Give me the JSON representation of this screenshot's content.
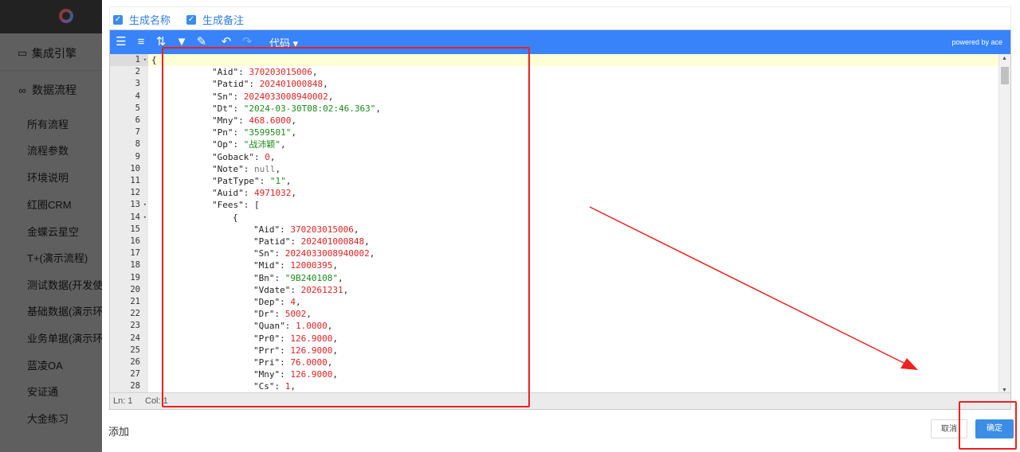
{
  "sidebar": {
    "sections": [
      {
        "icon": "engine-icon",
        "label": "集成引擎"
      },
      {
        "icon": "infinity-icon",
        "label": "数据流程"
      }
    ],
    "items": [
      {
        "label": "所有流程"
      },
      {
        "label": "流程参数"
      },
      {
        "label": "环境说明"
      },
      {
        "label": "红圈CRM"
      },
      {
        "label": "金蝶云星空"
      },
      {
        "label": "T+(演示流程)"
      },
      {
        "label": "测试数据(开发使用"
      },
      {
        "label": "基础数据(演示环境"
      },
      {
        "label": "业务单据(演示环境"
      },
      {
        "label": "蓝凌OA"
      },
      {
        "label": "安证通"
      },
      {
        "label": "大金练习"
      }
    ]
  },
  "options": {
    "generate_name": {
      "label": "生成名称",
      "checked": true
    },
    "generate_remark": {
      "label": "生成备注",
      "checked": true
    }
  },
  "editor": {
    "toolbar": {
      "icons": [
        "format-icon",
        "compact-icon",
        "sort-icon",
        "filter-icon",
        "repair-icon",
        "undo-icon",
        "redo-icon"
      ],
      "mode_label": "代码 ▾",
      "powered_by": "powered by ace"
    },
    "lines": [
      {
        "num": "1",
        "fold": true,
        "indent": 0,
        "text": "{",
        "tokens": [
          {
            "t": "{",
            "c": "p"
          }
        ]
      },
      {
        "num": "2",
        "indent": 1,
        "tokens": [
          {
            "t": "\"Aid\"",
            "c": "k"
          },
          {
            "t": ": ",
            "c": "p"
          },
          {
            "t": "370203015006",
            "c": "n"
          },
          {
            "t": ",",
            "c": "p"
          }
        ]
      },
      {
        "num": "3",
        "indent": 1,
        "tokens": [
          {
            "t": "\"Patid\"",
            "c": "k"
          },
          {
            "t": ": ",
            "c": "p"
          },
          {
            "t": "202401000848",
            "c": "n"
          },
          {
            "t": ",",
            "c": "p"
          }
        ]
      },
      {
        "num": "4",
        "indent": 1,
        "tokens": [
          {
            "t": "\"Sn\"",
            "c": "k"
          },
          {
            "t": ": ",
            "c": "p"
          },
          {
            "t": "2024033008940002",
            "c": "n"
          },
          {
            "t": ",",
            "c": "p"
          }
        ]
      },
      {
        "num": "5",
        "indent": 1,
        "tokens": [
          {
            "t": "\"Dt\"",
            "c": "k"
          },
          {
            "t": ": ",
            "c": "p"
          },
          {
            "t": "\"2024-03-30T08:02:46.363\"",
            "c": "s"
          },
          {
            "t": ",",
            "c": "p"
          }
        ]
      },
      {
        "num": "6",
        "indent": 1,
        "tokens": [
          {
            "t": "\"Mny\"",
            "c": "k"
          },
          {
            "t": ": ",
            "c": "p"
          },
          {
            "t": "468.6000",
            "c": "n"
          },
          {
            "t": ",",
            "c": "p"
          }
        ]
      },
      {
        "num": "7",
        "indent": 1,
        "tokens": [
          {
            "t": "\"Pn\"",
            "c": "k"
          },
          {
            "t": ": ",
            "c": "p"
          },
          {
            "t": "\"3599501\"",
            "c": "s"
          },
          {
            "t": ",",
            "c": "p"
          }
        ]
      },
      {
        "num": "8",
        "indent": 1,
        "tokens": [
          {
            "t": "\"Op\"",
            "c": "k"
          },
          {
            "t": ": ",
            "c": "p"
          },
          {
            "t": "\"战沛颖\"",
            "c": "s"
          },
          {
            "t": ",",
            "c": "p"
          }
        ]
      },
      {
        "num": "9",
        "indent": 1,
        "tokens": [
          {
            "t": "\"Goback\"",
            "c": "k"
          },
          {
            "t": ": ",
            "c": "p"
          },
          {
            "t": "0",
            "c": "n"
          },
          {
            "t": ",",
            "c": "p"
          }
        ]
      },
      {
        "num": "10",
        "indent": 1,
        "tokens": [
          {
            "t": "\"Note\"",
            "c": "k"
          },
          {
            "t": ": ",
            "c": "p"
          },
          {
            "t": "null",
            "c": "nl"
          },
          {
            "t": ",",
            "c": "p"
          }
        ]
      },
      {
        "num": "11",
        "indent": 1,
        "tokens": [
          {
            "t": "\"PatType\"",
            "c": "k"
          },
          {
            "t": ": ",
            "c": "p"
          },
          {
            "t": "\"1\"",
            "c": "s"
          },
          {
            "t": ",",
            "c": "p"
          }
        ]
      },
      {
        "num": "12",
        "indent": 1,
        "tokens": [
          {
            "t": "\"Auid\"",
            "c": "k"
          },
          {
            "t": ": ",
            "c": "p"
          },
          {
            "t": "4971032",
            "c": "n"
          },
          {
            "t": ",",
            "c": "p"
          }
        ]
      },
      {
        "num": "13",
        "fold": true,
        "indent": 1,
        "tokens": [
          {
            "t": "\"Fees\"",
            "c": "k"
          },
          {
            "t": ": [",
            "c": "p"
          }
        ]
      },
      {
        "num": "14",
        "fold": true,
        "indent": 2,
        "tokens": [
          {
            "t": "{",
            "c": "p"
          }
        ]
      },
      {
        "num": "15",
        "indent": 3,
        "tokens": [
          {
            "t": "\"Aid\"",
            "c": "k"
          },
          {
            "t": ": ",
            "c": "p"
          },
          {
            "t": "370203015006",
            "c": "n"
          },
          {
            "t": ",",
            "c": "p"
          }
        ]
      },
      {
        "num": "16",
        "indent": 3,
        "tokens": [
          {
            "t": "\"Patid\"",
            "c": "k"
          },
          {
            "t": ": ",
            "c": "p"
          },
          {
            "t": "202401000848",
            "c": "n"
          },
          {
            "t": ",",
            "c": "p"
          }
        ]
      },
      {
        "num": "17",
        "indent": 3,
        "tokens": [
          {
            "t": "\"Sn\"",
            "c": "k"
          },
          {
            "t": ": ",
            "c": "p"
          },
          {
            "t": "2024033008940002",
            "c": "n"
          },
          {
            "t": ",",
            "c": "p"
          }
        ]
      },
      {
        "num": "18",
        "indent": 3,
        "tokens": [
          {
            "t": "\"Mid\"",
            "c": "k"
          },
          {
            "t": ": ",
            "c": "p"
          },
          {
            "t": "12000395",
            "c": "n"
          },
          {
            "t": ",",
            "c": "p"
          }
        ]
      },
      {
        "num": "19",
        "indent": 3,
        "tokens": [
          {
            "t": "\"Bn\"",
            "c": "k"
          },
          {
            "t": ": ",
            "c": "p"
          },
          {
            "t": "\"9B240108\"",
            "c": "s"
          },
          {
            "t": ",",
            "c": "p"
          }
        ]
      },
      {
        "num": "20",
        "indent": 3,
        "tokens": [
          {
            "t": "\"Vdate\"",
            "c": "k"
          },
          {
            "t": ": ",
            "c": "p"
          },
          {
            "t": "20261231",
            "c": "n"
          },
          {
            "t": ",",
            "c": "p"
          }
        ]
      },
      {
        "num": "21",
        "indent": 3,
        "tokens": [
          {
            "t": "\"Dep\"",
            "c": "k"
          },
          {
            "t": ": ",
            "c": "p"
          },
          {
            "t": "4",
            "c": "n"
          },
          {
            "t": ",",
            "c": "p"
          }
        ]
      },
      {
        "num": "22",
        "indent": 3,
        "tokens": [
          {
            "t": "\"Dr\"",
            "c": "k"
          },
          {
            "t": ": ",
            "c": "p"
          },
          {
            "t": "5002",
            "c": "n"
          },
          {
            "t": ",",
            "c": "p"
          }
        ]
      },
      {
        "num": "23",
        "indent": 3,
        "tokens": [
          {
            "t": "\"Quan\"",
            "c": "k"
          },
          {
            "t": ": ",
            "c": "p"
          },
          {
            "t": "1.0000",
            "c": "n"
          },
          {
            "t": ",",
            "c": "p"
          }
        ]
      },
      {
        "num": "24",
        "indent": 3,
        "tokens": [
          {
            "t": "\"Pr0\"",
            "c": "k"
          },
          {
            "t": ": ",
            "c": "p"
          },
          {
            "t": "126.9000",
            "c": "n"
          },
          {
            "t": ",",
            "c": "p"
          }
        ]
      },
      {
        "num": "25",
        "indent": 3,
        "tokens": [
          {
            "t": "\"Prr\"",
            "c": "k"
          },
          {
            "t": ": ",
            "c": "p"
          },
          {
            "t": "126.9000",
            "c": "n"
          },
          {
            "t": ",",
            "c": "p"
          }
        ]
      },
      {
        "num": "26",
        "indent": 3,
        "tokens": [
          {
            "t": "\"Pri\"",
            "c": "k"
          },
          {
            "t": ": ",
            "c": "p"
          },
          {
            "t": "76.0000",
            "c": "n"
          },
          {
            "t": ",",
            "c": "p"
          }
        ]
      },
      {
        "num": "27",
        "indent": 3,
        "tokens": [
          {
            "t": "\"Mny\"",
            "c": "k"
          },
          {
            "t": ": ",
            "c": "p"
          },
          {
            "t": "126.9000",
            "c": "n"
          },
          {
            "t": ",",
            "c": "p"
          }
        ]
      },
      {
        "num": "28",
        "indent": 3,
        "tokens": [
          {
            "t": "\"Cs\"",
            "c": "k"
          },
          {
            "t": ": ",
            "c": "p"
          },
          {
            "t": "1",
            "c": "n"
          },
          {
            "t": ",",
            "c": "p"
          }
        ]
      }
    ],
    "status": {
      "ln": "Ln: 1",
      "col": "Col: 1"
    }
  },
  "footer": {
    "add_label": "添加",
    "cancel_label": "取消",
    "ok_label": "确定"
  },
  "colors": {
    "toolbar": "#3883fa",
    "primary": "#3b8de6",
    "annotation": "#ee2020",
    "json_string": "#1a8a1a",
    "json_number": "#d22"
  }
}
